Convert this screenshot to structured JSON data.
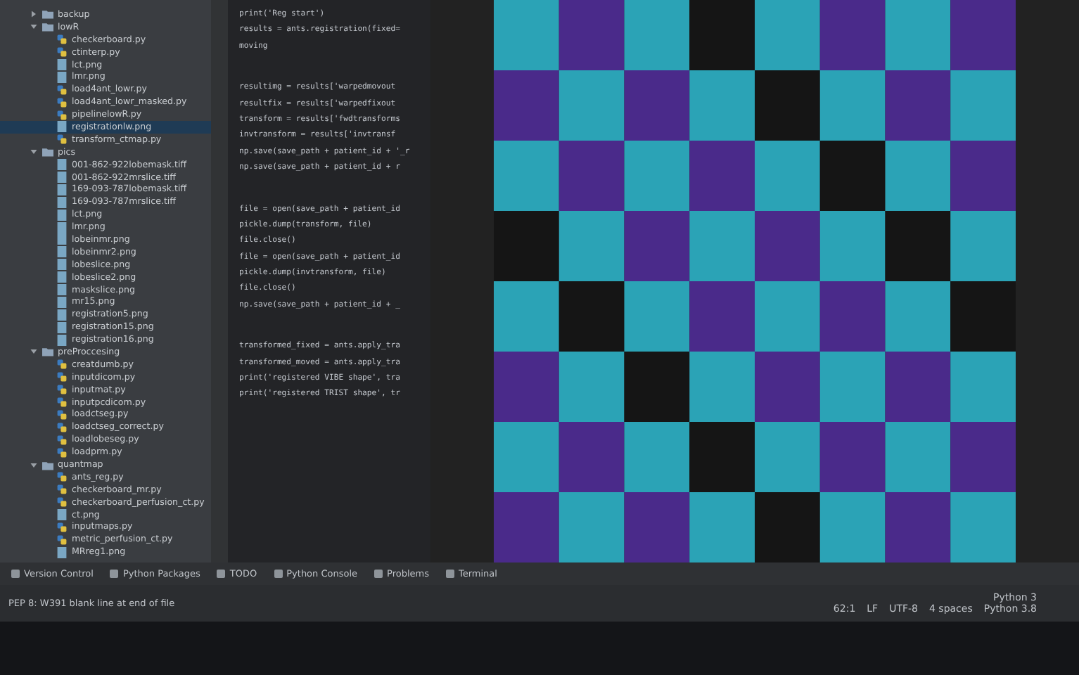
{
  "project_tree": [
    {
      "label": "backup",
      "kind": "folder",
      "expanded": false,
      "selected": false
    },
    {
      "label": "lowR",
      "kind": "folder",
      "expanded": true,
      "selected": false,
      "children": [
        {
          "label": "checkerboard.py",
          "kind": "py",
          "selected": false
        },
        {
          "label": "ctinterp.py",
          "kind": "py",
          "selected": false
        },
        {
          "label": "lct.png",
          "kind": "image",
          "selected": false
        },
        {
          "label": "lmr.png",
          "kind": "image",
          "selected": false
        },
        {
          "label": "load4ant_lowr.py",
          "kind": "py",
          "selected": false
        },
        {
          "label": "load4ant_lowr_masked.py",
          "kind": "py",
          "selected": false
        },
        {
          "label": "pipelinelowR.py",
          "kind": "py",
          "selected": false
        },
        {
          "label": "registrationlw.png",
          "kind": "image",
          "selected": true
        },
        {
          "label": "transform_ctmap.py",
          "kind": "py",
          "selected": false
        }
      ]
    },
    {
      "label": "pics",
      "kind": "folder",
      "expanded": true,
      "selected": false,
      "children": [
        {
          "label": "001-862-922lobemask.tiff",
          "kind": "image",
          "selected": false
        },
        {
          "label": "001-862-922mrslice.tiff",
          "kind": "image",
          "selected": false
        },
        {
          "label": "169-093-787lobemask.tiff",
          "kind": "image",
          "selected": false
        },
        {
          "label": "169-093-787mrslice.tiff",
          "kind": "image",
          "selected": false
        },
        {
          "label": "lct.png",
          "kind": "image",
          "selected": false
        },
        {
          "label": "lmr.png",
          "kind": "image",
          "selected": false
        },
        {
          "label": "lobeinmr.png",
          "kind": "image",
          "selected": false
        },
        {
          "label": "lobeinmr2.png",
          "kind": "image",
          "selected": false
        },
        {
          "label": "lobeslice.png",
          "kind": "image",
          "selected": false
        },
        {
          "label": "lobeslice2.png",
          "kind": "image",
          "selected": false
        },
        {
          "label": "maskslice.png",
          "kind": "image",
          "selected": false
        },
        {
          "label": "mr15.png",
          "kind": "image",
          "selected": false
        },
        {
          "label": "registration5.png",
          "kind": "image",
          "selected": false
        },
        {
          "label": "registration15.png",
          "kind": "image",
          "selected": false
        },
        {
          "label": "registration16.png",
          "kind": "image",
          "selected": false
        }
      ]
    },
    {
      "label": "preProccesing",
      "kind": "folder",
      "expanded": true,
      "selected": false,
      "children": [
        {
          "label": "creatdumb.py",
          "kind": "py",
          "selected": false
        },
        {
          "label": "inputdicom.py",
          "kind": "py",
          "selected": false
        },
        {
          "label": "inputmat.py",
          "kind": "py",
          "selected": false
        },
        {
          "label": "inputpcdicom.py",
          "kind": "py",
          "selected": false
        },
        {
          "label": "loadctseg.py",
          "kind": "py",
          "selected": false
        },
        {
          "label": "loadctseg_correct.py",
          "kind": "py",
          "selected": false
        },
        {
          "label": "loadlobeseg.py",
          "kind": "py",
          "selected": false
        },
        {
          "label": "loadprm.py",
          "kind": "py",
          "selected": false
        }
      ]
    },
    {
      "label": "quantmap",
      "kind": "folder",
      "expanded": true,
      "selected": false,
      "children": [
        {
          "label": "ants_reg.py",
          "kind": "py",
          "selected": false
        },
        {
          "label": "checkerboard_mr.py",
          "kind": "py",
          "selected": false
        },
        {
          "label": "checkerboard_perfusion_ct.py",
          "kind": "py",
          "selected": false
        },
        {
          "label": "ct.png",
          "kind": "image",
          "selected": false
        },
        {
          "label": "inputmaps.py",
          "kind": "py",
          "selected": false
        },
        {
          "label": "metric_perfusion_ct.py",
          "kind": "py",
          "selected": false
        },
        {
          "label": "MRreg1.png",
          "kind": "image",
          "selected": false
        }
      ]
    }
  ],
  "code_blocks": [
    [
      "print('Reg start')",
      "results = ants.registration(fixed=",
      "moving"
    ],
    [
      "resultimg = results['warpedmovout",
      "resultfix = results['warpedfixout",
      "transform = results['fwdtransforms",
      "invtransform = results['invtransf",
      "np.save(save_path + patient_id + '_r",
      "np.save(save_path + patient_id + r"
    ],
    [
      "file = open(save_path + patient_id",
      "pickle.dump(transform, file)",
      "file.close()",
      "file = open(save_path + patient_id",
      "pickle.dump(invtransform, file)",
      "file.close()",
      "np.save(save_path + patient_id + _"
    ],
    [
      "transformed_fixed = ants.apply_tra",
      "transformed_moved = ants.apply_tra",
      "print('registered VIBE shape', tra",
      "print('registered TRIST shape', tr"
    ]
  ],
  "tool_tabs": [
    "Version Control",
    "Python Packages",
    "TODO",
    "Python Console",
    "Problems",
    "Terminal"
  ],
  "status_bar": {
    "message": "PEP 8: W391 blank line at end of file",
    "interpreter_label": "Python 3",
    "items": [
      "62:1",
      "LF",
      "UTF-8",
      "4 spaces",
      "Python 3.8"
    ]
  }
}
